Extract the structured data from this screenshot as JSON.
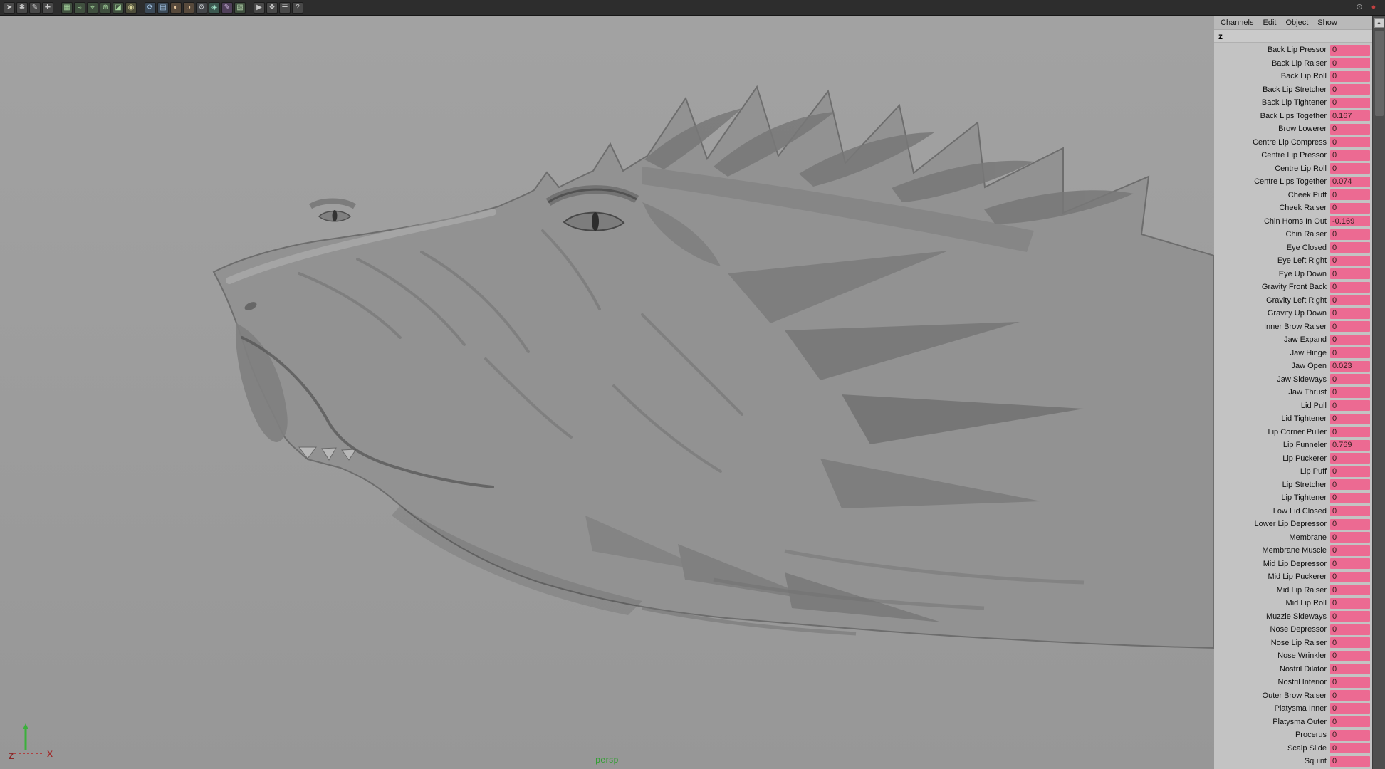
{
  "topbar": {
    "icons": [
      {
        "name": "select-tool-icon",
        "glyph": "➤",
        "bg": "#494949",
        "fg": "#d0d0d0"
      },
      {
        "name": "lasso-tool-icon",
        "glyph": "✱",
        "bg": "#494949",
        "fg": "#c8c8c8"
      },
      {
        "name": "paint-select-tool-icon",
        "glyph": "✎",
        "bg": "#494949",
        "fg": "#c8c8c8"
      },
      {
        "name": "move-tool-icon",
        "glyph": "✚",
        "bg": "#494949",
        "fg": "#c8c8c8"
      },
      {
        "sep": true
      },
      {
        "name": "snap-to-grid-icon",
        "glyph": "▦",
        "bg": "#40503f",
        "fg": "#a8d8a0"
      },
      {
        "name": "snap-to-curve-icon",
        "glyph": "≈",
        "bg": "#40503f",
        "fg": "#a8d8a0"
      },
      {
        "name": "snap-to-point-icon",
        "glyph": "⌖",
        "bg": "#40503f",
        "fg": "#a8d8a0"
      },
      {
        "name": "snap-to-projected-center-icon",
        "glyph": "⊕",
        "bg": "#40503f",
        "fg": "#a8d8a0"
      },
      {
        "name": "snap-to-view-plane-icon",
        "glyph": "◪",
        "bg": "#40503f",
        "fg": "#a8d8a0"
      },
      {
        "name": "make-object-live-icon",
        "glyph": "◉",
        "bg": "#4f4f3b",
        "fg": "#d8d49c"
      },
      {
        "sep": true
      },
      {
        "name": "construction-history-icon",
        "glyph": "⟳",
        "bg": "#3c4a58",
        "fg": "#a8c8e8"
      },
      {
        "name": "open-render-view-icon",
        "glyph": "▤",
        "bg": "#3c4a58",
        "fg": "#a8c8e8"
      },
      {
        "name": "render-current-frame-icon",
        "glyph": "◐",
        "bg": "#584a3c",
        "fg": "#e8c8a0"
      },
      {
        "name": "ipr-render-icon",
        "glyph": "◑",
        "bg": "#584a3c",
        "fg": "#e8c8a0"
      },
      {
        "name": "render-settings-icon",
        "glyph": "⚙",
        "bg": "#44464a",
        "fg": "#c0c4c8"
      },
      {
        "name": "hypershade-icon",
        "glyph": "◈",
        "bg": "#3c5850",
        "fg": "#a0e0c8"
      },
      {
        "name": "paint-effects-icon",
        "glyph": "✎",
        "bg": "#50405a",
        "fg": "#d0b8e0"
      },
      {
        "name": "uv-editor-icon",
        "glyph": "▧",
        "bg": "#40503f",
        "fg": "#b8d8b0"
      },
      {
        "sep": true
      },
      {
        "name": "playblast-icon",
        "glyph": "▶",
        "bg": "#494949",
        "fg": "#c8c8c8"
      },
      {
        "name": "plugin-manager-icon",
        "glyph": "❖",
        "bg": "#494949",
        "fg": "#c8c8c8"
      },
      {
        "name": "script-editor-icon",
        "glyph": "☰",
        "bg": "#494949",
        "fg": "#c8c8c8"
      },
      {
        "name": "help-icon",
        "glyph": "?",
        "bg": "#494949",
        "fg": "#c8c8c8"
      }
    ],
    "right_icons": [
      {
        "name": "camera-hud-icon",
        "glyph": "⊙",
        "bg": "transparent",
        "fg": "#9a9a9a"
      },
      {
        "name": "record-indicator-icon",
        "glyph": "●",
        "bg": "transparent",
        "fg": "#c04040"
      }
    ]
  },
  "viewport": {
    "camera_label": "persp",
    "axis_z": "Z",
    "axis_x": "X",
    "axis_y_color": "#3bb03b",
    "axis_label_color": "#8a2828"
  },
  "channel_box": {
    "menus": [
      "Channels",
      "Edit",
      "Object",
      "Show"
    ],
    "object_name": "z",
    "scroll_up_glyph": "▴",
    "field_color": "#ec6a92",
    "rows": [
      {
        "label": "Back Lip Pressor",
        "value": "0"
      },
      {
        "label": "Back Lip Raiser",
        "value": "0"
      },
      {
        "label": "Back Lip Roll",
        "value": "0"
      },
      {
        "label": "Back Lip Stretcher",
        "value": "0"
      },
      {
        "label": "Back Lip Tightener",
        "value": "0"
      },
      {
        "label": "Back Lips Together",
        "value": "0.167"
      },
      {
        "label": "Brow Lowerer",
        "value": "0"
      },
      {
        "label": "Centre Lip Compress",
        "value": "0"
      },
      {
        "label": "Centre Lip Pressor",
        "value": "0"
      },
      {
        "label": "Centre Lip Roll",
        "value": "0"
      },
      {
        "label": "Centre Lips Together",
        "value": "0.074"
      },
      {
        "label": "Cheek Puff",
        "value": "0"
      },
      {
        "label": "Cheek Raiser",
        "value": "0"
      },
      {
        "label": "Chin Horns In Out",
        "value": "-0.169"
      },
      {
        "label": "Chin Raiser",
        "value": "0"
      },
      {
        "label": "Eye Closed",
        "value": "0"
      },
      {
        "label": "Eye Left Right",
        "value": "0"
      },
      {
        "label": "Eye Up Down",
        "value": "0"
      },
      {
        "label": "Gravity Front Back",
        "value": "0"
      },
      {
        "label": "Gravity Left Right",
        "value": "0"
      },
      {
        "label": "Gravity Up Down",
        "value": "0"
      },
      {
        "label": "Inner Brow Raiser",
        "value": "0"
      },
      {
        "label": "Jaw Expand",
        "value": "0"
      },
      {
        "label": "Jaw Hinge",
        "value": "0"
      },
      {
        "label": "Jaw Open",
        "value": "0.023"
      },
      {
        "label": "Jaw Sideways",
        "value": "0"
      },
      {
        "label": "Jaw Thrust",
        "value": "0"
      },
      {
        "label": "Lid Pull",
        "value": "0"
      },
      {
        "label": "Lid Tightener",
        "value": "0"
      },
      {
        "label": "Lip Corner Puller",
        "value": "0"
      },
      {
        "label": "Lip Funneler",
        "value": "0.769"
      },
      {
        "label": "Lip Puckerer",
        "value": "0"
      },
      {
        "label": "Lip Puff",
        "value": "0"
      },
      {
        "label": "Lip Stretcher",
        "value": "0"
      },
      {
        "label": "Lip Tightener",
        "value": "0"
      },
      {
        "label": "Low Lid Closed",
        "value": "0"
      },
      {
        "label": "Lower Lip Depressor",
        "value": "0"
      },
      {
        "label": "Membrane",
        "value": "0"
      },
      {
        "label": "Membrane Muscle",
        "value": "0"
      },
      {
        "label": "Mid Lip Depressor",
        "value": "0"
      },
      {
        "label": "Mid Lip Puckerer",
        "value": "0"
      },
      {
        "label": "Mid Lip Raiser",
        "value": "0"
      },
      {
        "label": "Mid Lip Roll",
        "value": "0"
      },
      {
        "label": "Muzzle Sideways",
        "value": "0"
      },
      {
        "label": "Nose Depressor",
        "value": "0"
      },
      {
        "label": "Nose Lip Raiser",
        "value": "0"
      },
      {
        "label": "Nose Wrinkler",
        "value": "0"
      },
      {
        "label": "Nostril Dilator",
        "value": "0"
      },
      {
        "label": "Nostril Interior",
        "value": "0"
      },
      {
        "label": "Outer Brow Raiser",
        "value": "0"
      },
      {
        "label": "Platysma Inner",
        "value": "0"
      },
      {
        "label": "Platysma Outer",
        "value": "0"
      },
      {
        "label": "Procerus",
        "value": "0"
      },
      {
        "label": "Scalp Slide",
        "value": "0"
      },
      {
        "label": "Squint",
        "value": "0"
      }
    ]
  }
}
